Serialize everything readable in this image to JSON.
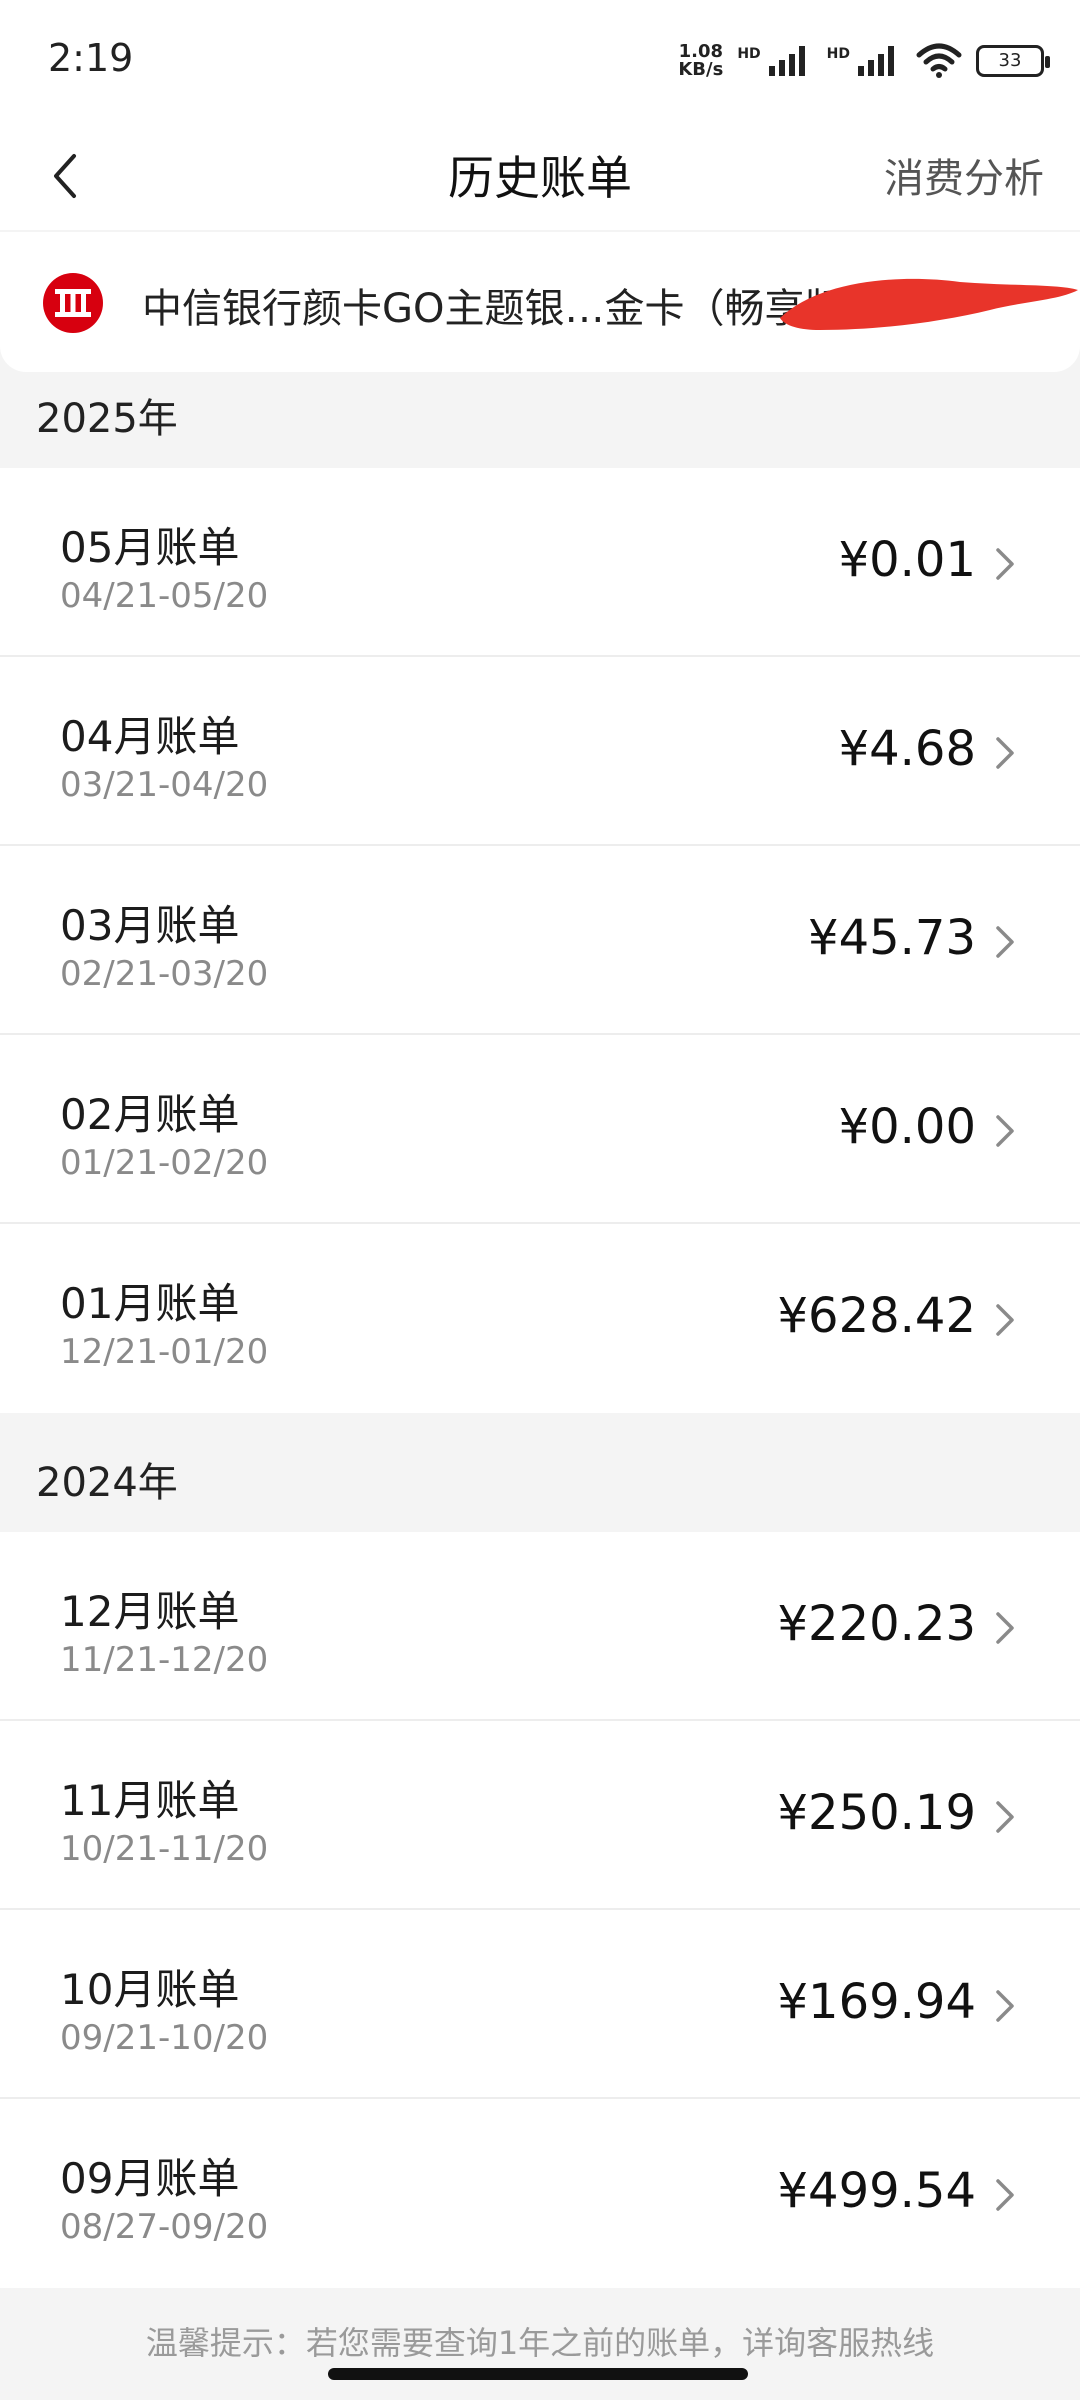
{
  "status_bar": {
    "time": "2:19",
    "net_speed_value": "1.08",
    "net_speed_unit": "KB/s",
    "hd_label": "HD",
    "battery": "33"
  },
  "nav": {
    "title": "历史账单",
    "analysis": "消费分析"
  },
  "card": {
    "name": "中信银行颜卡GO主题银…金卡（畅享版）"
  },
  "years": [
    {
      "year": "2025年",
      "bills": [
        {
          "title": "05月账单",
          "period": "04/21-05/20",
          "amount": "¥0.01"
        },
        {
          "title": "04月账单",
          "period": "03/21-04/20",
          "amount": "¥4.68"
        },
        {
          "title": "03月账单",
          "period": "02/21-03/20",
          "amount": "¥45.73"
        },
        {
          "title": "02月账单",
          "period": "01/21-02/20",
          "amount": "¥0.00"
        },
        {
          "title": "01月账单",
          "period": "12/21-01/20",
          "amount": "¥628.42"
        }
      ]
    },
    {
      "year": "2024年",
      "bills": [
        {
          "title": "12月账单",
          "period": "11/21-12/20",
          "amount": "¥220.23"
        },
        {
          "title": "11月账单",
          "period": "10/21-11/20",
          "amount": "¥250.19"
        },
        {
          "title": "10月账单",
          "period": "09/21-10/20",
          "amount": "¥169.94"
        },
        {
          "title": "09月账单",
          "period": "08/27-09/20",
          "amount": "¥499.54"
        }
      ]
    }
  ],
  "hint": "温馨提示：若您需要查询1年之前的账单，详询客服热线",
  "colors": {
    "brand_red": "#d7000f",
    "redaction": "#e8342a",
    "background": "#f4f4f4"
  }
}
